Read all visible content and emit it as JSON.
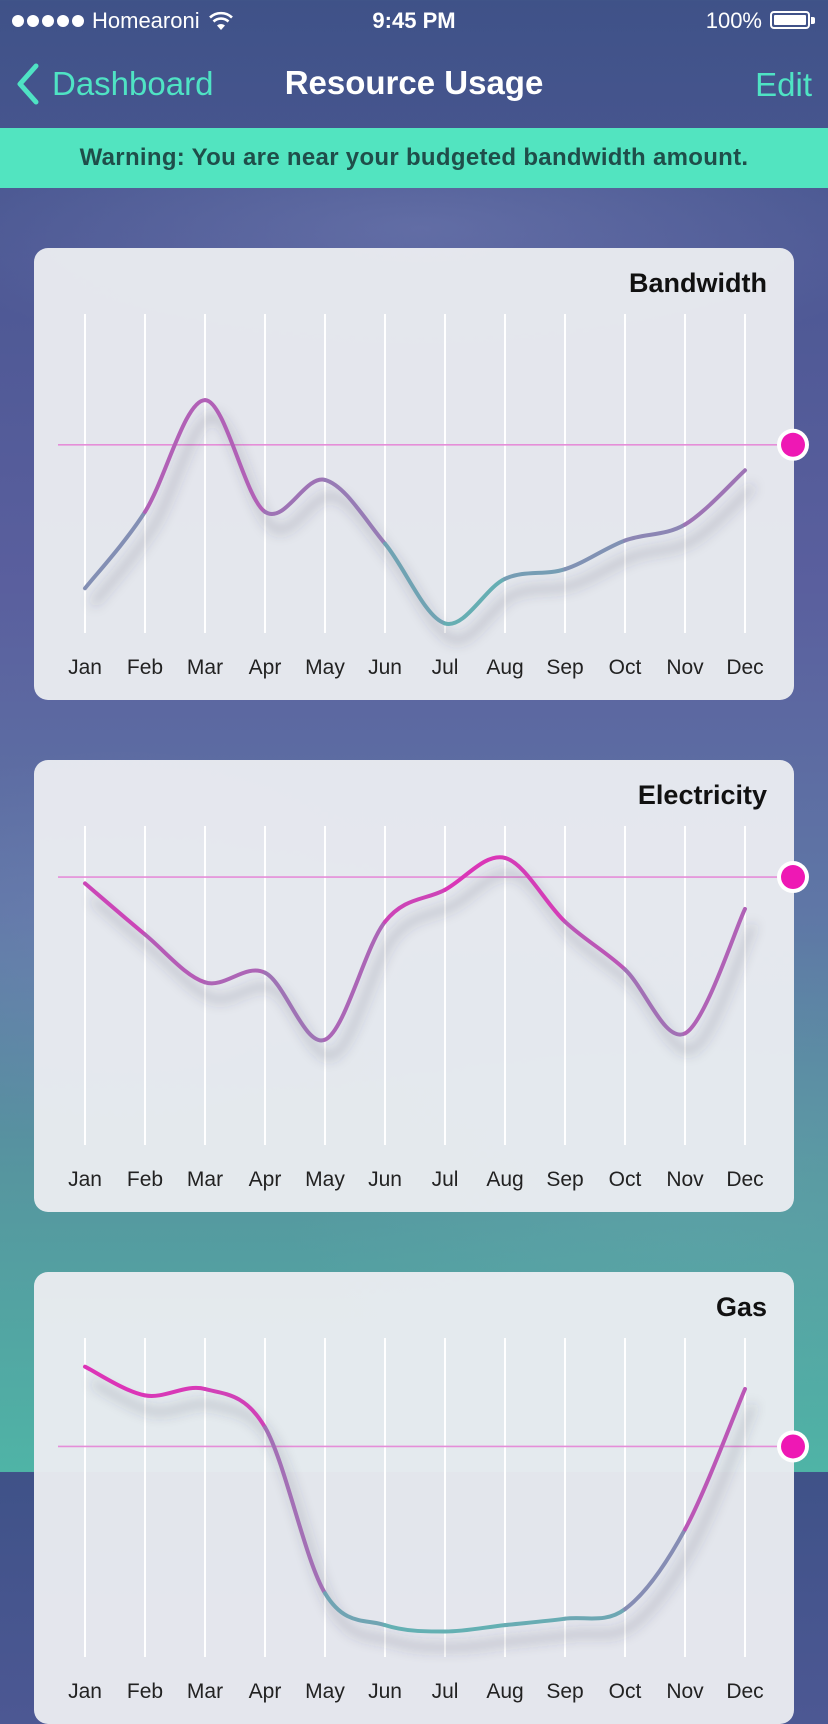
{
  "status_bar": {
    "carrier": "Homearoni",
    "time": "9:45 PM",
    "battery": "100%"
  },
  "nav": {
    "back_label": "Dashboard",
    "title": "Resource Usage",
    "edit_label": "Edit"
  },
  "warning": {
    "text": "Warning: You are near your budgeted bandwidth amount."
  },
  "colors": {
    "accent": "#4fe3c4",
    "warning_bg": "#52e4c0",
    "line_high": "#ee22b8",
    "line_low": "#4cc8b2",
    "budget": "#ee18b4"
  },
  "chart_data": [
    {
      "type": "line",
      "title": "Bandwidth",
      "categories": [
        "Jan",
        "Feb",
        "Mar",
        "Apr",
        "May",
        "Jun",
        "Jul",
        "Aug",
        "Sep",
        "Oct",
        "Nov",
        "Dec"
      ],
      "values": [
        0.14,
        0.38,
        0.73,
        0.38,
        0.48,
        0.28,
        0.03,
        0.17,
        0.2,
        0.29,
        0.34,
        0.51
      ],
      "budget": 0.59,
      "ylim": [
        0,
        1
      ],
      "grid": "vertical"
    },
    {
      "type": "line",
      "title": "Electricity",
      "categories": [
        "Jan",
        "Feb",
        "Mar",
        "Apr",
        "May",
        "Jun",
        "Jul",
        "Aug",
        "Sep",
        "Oct",
        "Nov",
        "Dec"
      ],
      "values": [
        0.82,
        0.66,
        0.51,
        0.54,
        0.33,
        0.7,
        0.8,
        0.9,
        0.7,
        0.55,
        0.35,
        0.74
      ],
      "budget": 0.84,
      "ylim": [
        0,
        1
      ],
      "grid": "vertical"
    },
    {
      "type": "line",
      "title": "Gas",
      "categories": [
        "Jan",
        "Feb",
        "Mar",
        "Apr",
        "May",
        "Jun",
        "Jul",
        "Aug",
        "Sep",
        "Oct",
        "Nov",
        "Dec"
      ],
      "values": [
        0.91,
        0.82,
        0.84,
        0.72,
        0.2,
        0.1,
        0.08,
        0.1,
        0.12,
        0.15,
        0.4,
        0.84
      ],
      "budget": 0.66,
      "ylim": [
        0,
        1
      ],
      "grid": "vertical"
    }
  ]
}
